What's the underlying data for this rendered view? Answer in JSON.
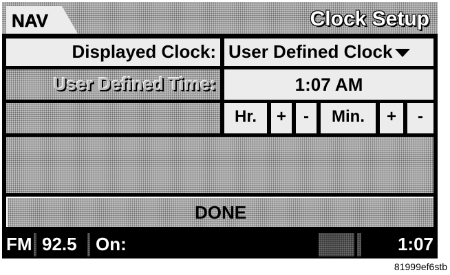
{
  "header": {
    "nav_tab_label": "NAV",
    "title": "Clock Setup"
  },
  "displayed_clock": {
    "label": "Displayed Clock:",
    "value": "User Defined Clock",
    "dropdown_icon": "triangle-down-icon"
  },
  "user_time": {
    "label": "User Defined Time:",
    "value": "1:07 AM"
  },
  "adjust": {
    "hour_label": "Hr.",
    "hour_plus": "+",
    "hour_minus": "-",
    "minute_label": "Min.",
    "minute_plus": "+",
    "minute_minus": "-"
  },
  "done_label": "DONE",
  "status_bar": {
    "band": "FM",
    "frequency": "92.5",
    "on_label": "On:",
    "clock": "1:07"
  },
  "caption": "81999ef6stb"
}
